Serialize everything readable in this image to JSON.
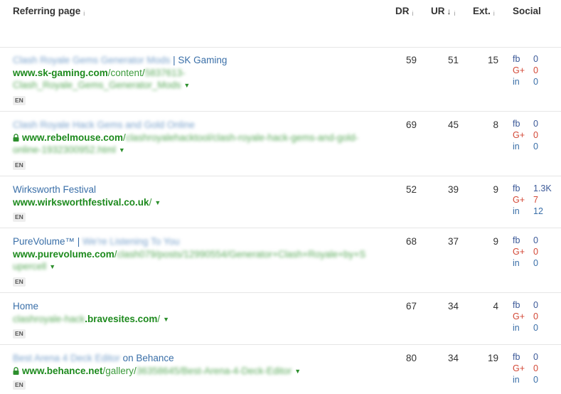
{
  "header": {
    "referring_page": "Referring page",
    "dr": "DR",
    "ur": "UR",
    "ext": "Ext.",
    "social": "Social",
    "info_glyph": "i",
    "sort_glyph": "↓"
  },
  "social_labels": {
    "fb": "fb",
    "gplus": "G+",
    "in": "in"
  },
  "badge": "EN",
  "rows": [
    {
      "title_blur": "Clash Royale Gems Generator Mods",
      "title_clear": " | SK Gaming",
      "url_domain": "www.sk-gaming.com",
      "url_path": "/content/",
      "url_blur1": "5837613-",
      "url_blur2": "Clash_Royale_Gems_Generator_Mods",
      "secure": false,
      "dr": "59",
      "ur": "51",
      "ext": "15",
      "fb": "0",
      "gplus": "0",
      "in": "0"
    },
    {
      "title_blur": "Clash Royale Hack Gems and Gold Online",
      "url_domain": "www.rebelmouse.com",
      "url_path": "/",
      "url_blur1": "clashroyalehacktool/clash-royale-hack-gems-and-gold-",
      "url_blur2": "online-1932300952.html",
      "secure": true,
      "dr": "69",
      "ur": "45",
      "ext": "8",
      "fb": "0",
      "gplus": "0",
      "in": "0"
    },
    {
      "title_clear": "Wirksworth Festival",
      "url_domain": "www.wirksworthfestival.co.uk",
      "url_path": "/",
      "secure": false,
      "dr": "52",
      "ur": "39",
      "ext": "9",
      "fb": "1.3K",
      "gplus": "7",
      "in": "12"
    },
    {
      "title_clear": "PureVolume™ | ",
      "title_blur": "We're Listening To You",
      "url_domain": "www.purevolume.com",
      "url_path": "/",
      "url_blur1": "clash079/posts/12990554/Generator+Clash+Royale+by+S",
      "url_blur2": "upercell",
      "secure": false,
      "dr": "68",
      "ur": "37",
      "ext": "9",
      "fb": "0",
      "gplus": "0",
      "in": "0"
    },
    {
      "title_clear": "Home",
      "url_blur_prefix": "clashroyale-hack",
      "url_domain": ".bravesites.com",
      "url_path": "/",
      "secure": false,
      "dr": "67",
      "ur": "34",
      "ext": "4",
      "fb": "0",
      "gplus": "0",
      "in": "0"
    },
    {
      "title_blur": "Best Arena 4 Deck Editor",
      "title_clear": " on Behance",
      "url_domain": "www.behance.net",
      "url_path": "/gallery/",
      "url_blur1": "36358645/Best-Arena-4-Deck-Editor",
      "secure": true,
      "dr": "80",
      "ur": "34",
      "ext": "19",
      "fb": "0",
      "gplus": "0",
      "in": "0"
    }
  ]
}
